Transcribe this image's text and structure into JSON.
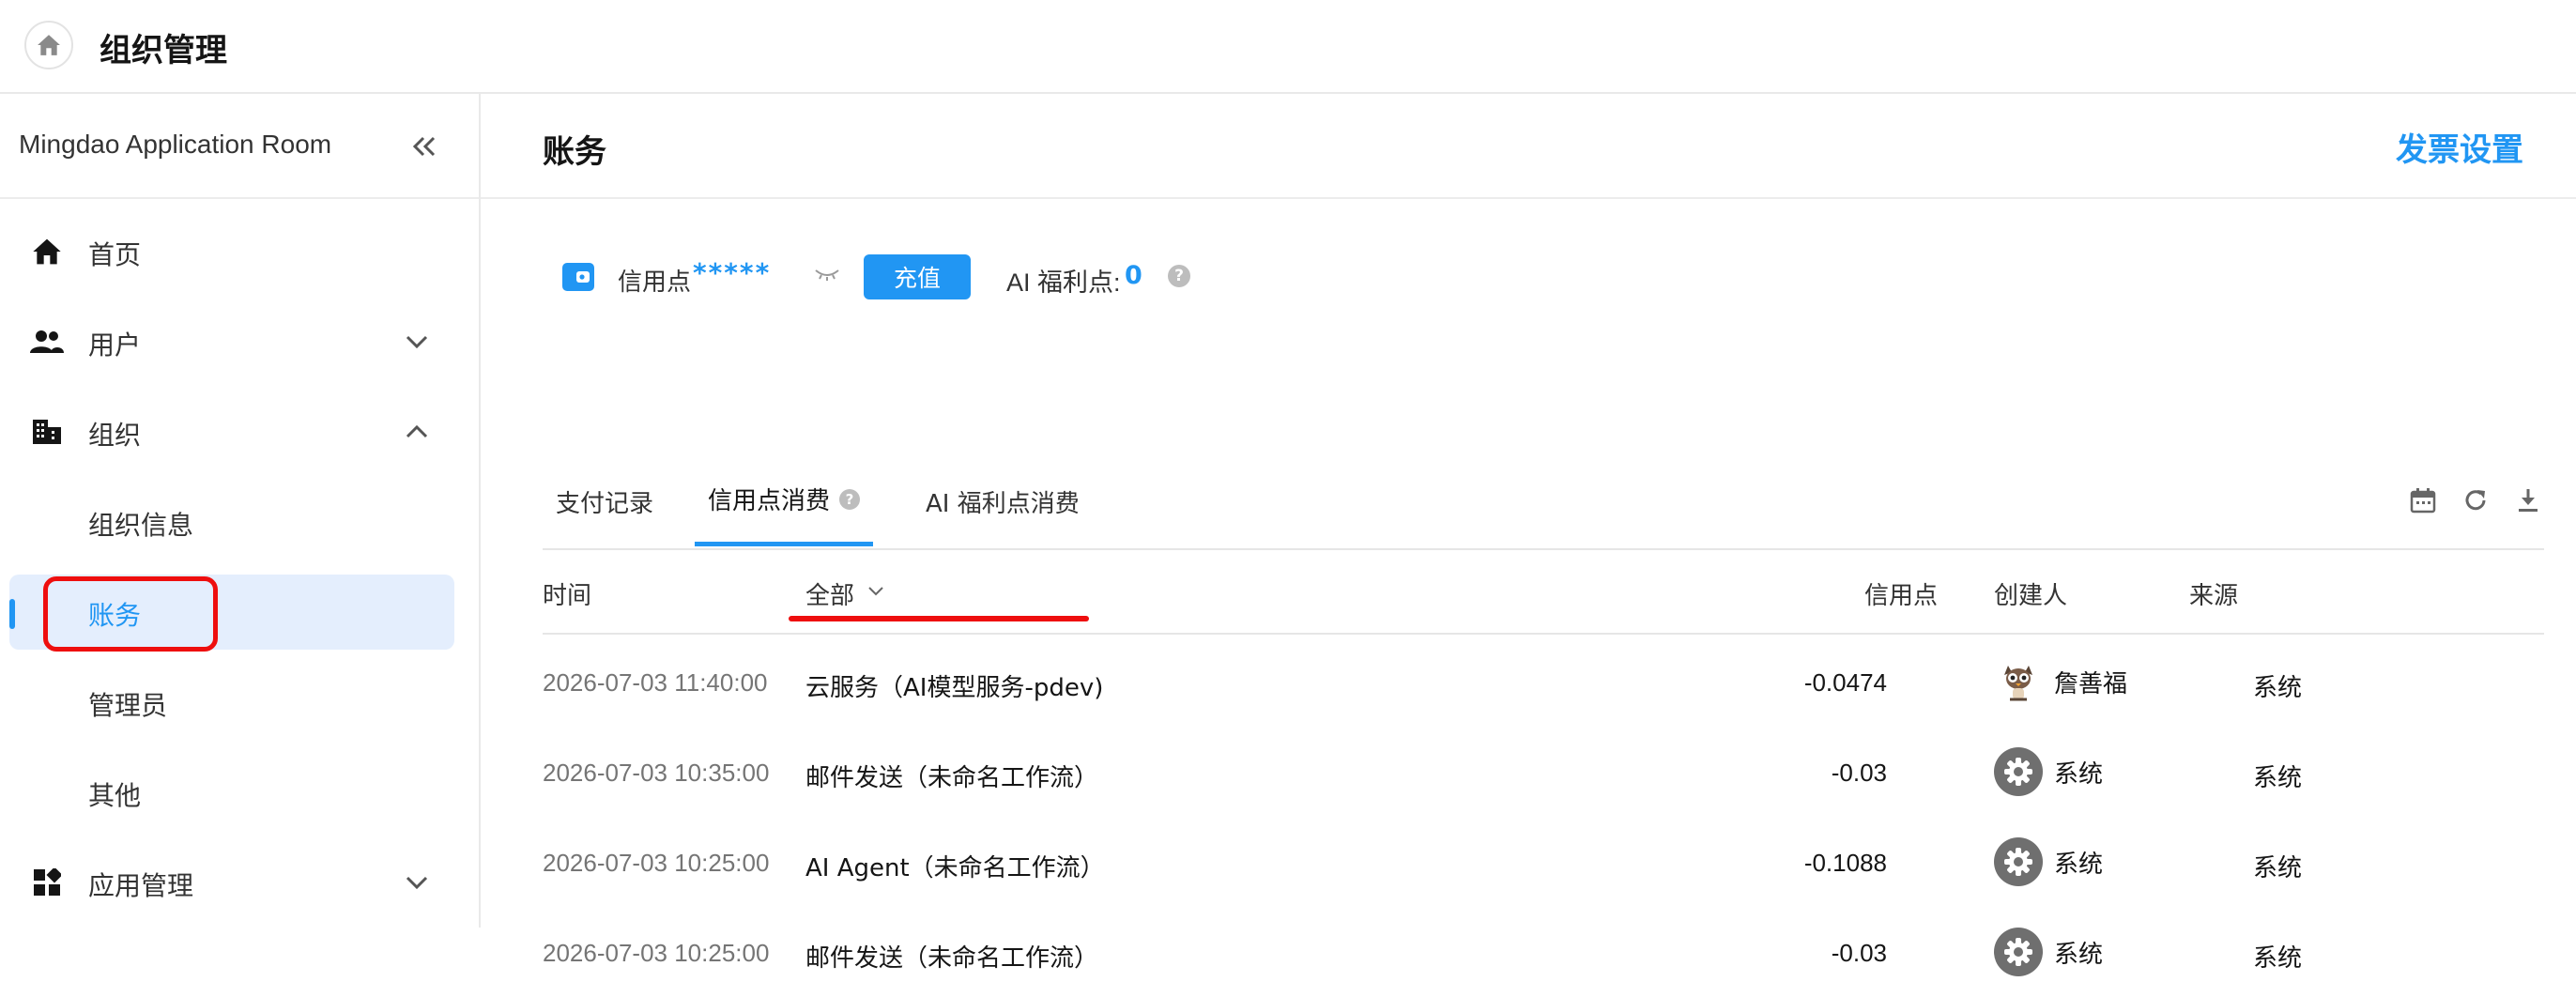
{
  "header": {
    "title": "组织管理",
    "home_icon": "home-icon"
  },
  "sidebar": {
    "org_name": "Mingdao Application Room",
    "items": [
      {
        "label": "首页",
        "icon": "home-icon"
      },
      {
        "label": "用户",
        "icon": "users-icon"
      },
      {
        "label": "组织",
        "icon": "building-icon"
      },
      {
        "label": "组织信息"
      },
      {
        "label": "账务"
      },
      {
        "label": "管理员"
      },
      {
        "label": "其他"
      },
      {
        "label": "应用管理",
        "icon": "apps-icon"
      }
    ]
  },
  "main": {
    "title": "账务",
    "invoice_settings": "发票设置",
    "credit": {
      "label": "信用点",
      "value": "*****",
      "recharge": "充值",
      "ai_label": "AI 福利点:",
      "ai_value": "0"
    },
    "tabs": [
      {
        "label": "支付记录"
      },
      {
        "label": "信用点消费"
      },
      {
        "label": "AI 福利点消费"
      }
    ],
    "table": {
      "headers": {
        "time": "时间",
        "filter": "全部",
        "credit": "信用点",
        "creator": "创建人",
        "source": "来源"
      },
      "rows": [
        {
          "time": "2026-07-03 11:40:00",
          "desc": "云服务（AI模型服务-pdev)",
          "credit": "-0.0474",
          "creator": "詹善福",
          "source": "系统"
        },
        {
          "time": "2026-07-03 10:35:00",
          "desc": "邮件发送（未命名工作流）",
          "credit": "-0.03",
          "creator": "系统",
          "source": "系统"
        },
        {
          "time": "2026-07-03 10:25:00",
          "desc": "AI Agent（未命名工作流）",
          "credit": "-0.1088",
          "creator": "系统",
          "source": "系统"
        },
        {
          "time": "2026-07-03 10:25:00",
          "desc": "邮件发送（未命名工作流）",
          "credit": "-0.03",
          "creator": "系统",
          "source": "系统"
        }
      ]
    }
  },
  "colors": {
    "accent": "#2196f3",
    "annotation": "#ee0e0e",
    "active_bg": "#e4eefd"
  }
}
